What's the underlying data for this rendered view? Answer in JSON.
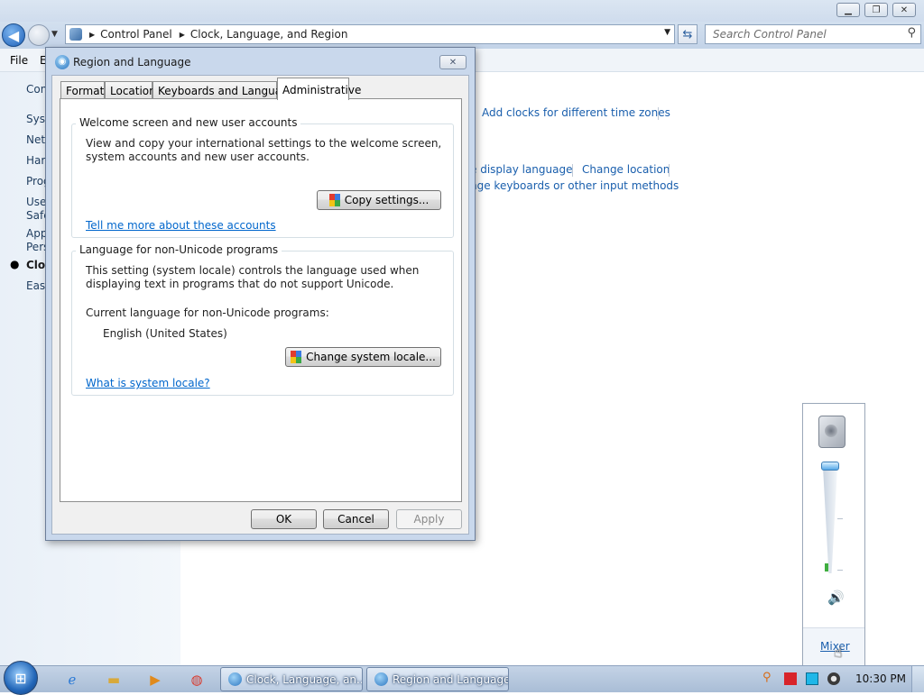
{
  "explorer": {
    "address": {
      "crumbs": [
        "Control Panel",
        "Clock, Language, and Region"
      ]
    },
    "search_placeholder": "Search Control Panel",
    "menu": {
      "file": "File",
      "edit_partial": "E"
    },
    "left_pane": {
      "items": [
        "Con",
        "Syst",
        "Netv",
        "Harc",
        "Prog",
        "User",
        "Safe",
        "App",
        "Pers",
        "Cloc",
        "Ease"
      ]
    },
    "content_links": {
      "add_clocks": "Add clocks for different time zones",
      "display_language": "e display language",
      "change_location": "Change location",
      "change_keyboards": "nge keyboards or other input methods"
    }
  },
  "dialog": {
    "title": "Region and Language",
    "tabs": [
      "Formats",
      "Location",
      "Keyboards and Languages",
      "Administrative"
    ],
    "active_tab": "Administrative",
    "welcome_group": {
      "title": "Welcome screen and new user accounts",
      "description": "View and copy your international settings to the welcome screen, system accounts and new user accounts.",
      "copy_button": "Copy settings...",
      "link": "Tell me more about these accounts"
    },
    "unicode_group": {
      "title": "Language for non-Unicode programs",
      "description": "This setting (system locale) controls the language used when displaying text in programs that do not support Unicode.",
      "current_label": "Current language for non-Unicode programs:",
      "current_value": "English (United States)",
      "change_button": "Change system locale...",
      "link": "What is system locale?"
    },
    "buttons": {
      "ok": "OK",
      "cancel": "Cancel",
      "apply": "Apply"
    }
  },
  "volume_flyout": {
    "level": 0.05,
    "mixer_link": "Mixer"
  },
  "taskbar": {
    "tasks": [
      "Clock, Language, an...",
      "Region and Language"
    ],
    "clock": "10:30 PM"
  }
}
